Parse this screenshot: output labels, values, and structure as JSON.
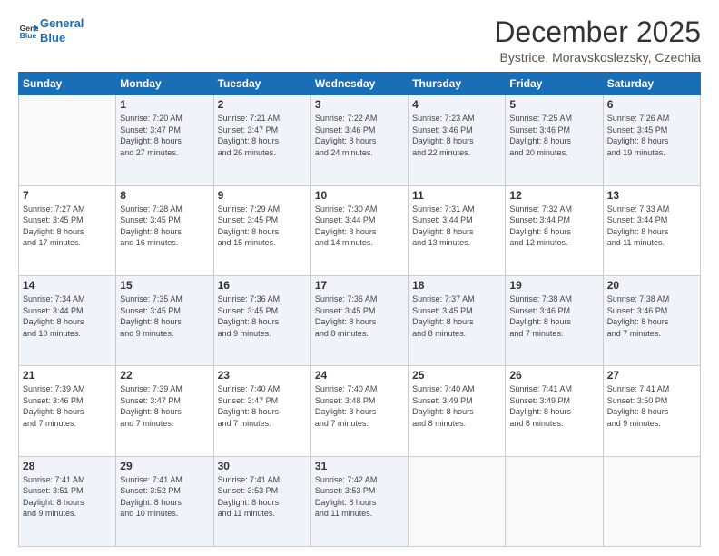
{
  "logo": {
    "line1": "General",
    "line2": "Blue"
  },
  "title": "December 2025",
  "subtitle": "Bystrice, Moravskoslezsky, Czechia",
  "days_header": [
    "Sunday",
    "Monday",
    "Tuesday",
    "Wednesday",
    "Thursday",
    "Friday",
    "Saturday"
  ],
  "weeks": [
    [
      {
        "day": "",
        "info": ""
      },
      {
        "day": "1",
        "info": "Sunrise: 7:20 AM\nSunset: 3:47 PM\nDaylight: 8 hours\nand 27 minutes."
      },
      {
        "day": "2",
        "info": "Sunrise: 7:21 AM\nSunset: 3:47 PM\nDaylight: 8 hours\nand 26 minutes."
      },
      {
        "day": "3",
        "info": "Sunrise: 7:22 AM\nSunset: 3:46 PM\nDaylight: 8 hours\nand 24 minutes."
      },
      {
        "day": "4",
        "info": "Sunrise: 7:23 AM\nSunset: 3:46 PM\nDaylight: 8 hours\nand 22 minutes."
      },
      {
        "day": "5",
        "info": "Sunrise: 7:25 AM\nSunset: 3:46 PM\nDaylight: 8 hours\nand 20 minutes."
      },
      {
        "day": "6",
        "info": "Sunrise: 7:26 AM\nSunset: 3:45 PM\nDaylight: 8 hours\nand 19 minutes."
      }
    ],
    [
      {
        "day": "7",
        "info": "Sunrise: 7:27 AM\nSunset: 3:45 PM\nDaylight: 8 hours\nand 17 minutes."
      },
      {
        "day": "8",
        "info": "Sunrise: 7:28 AM\nSunset: 3:45 PM\nDaylight: 8 hours\nand 16 minutes."
      },
      {
        "day": "9",
        "info": "Sunrise: 7:29 AM\nSunset: 3:45 PM\nDaylight: 8 hours\nand 15 minutes."
      },
      {
        "day": "10",
        "info": "Sunrise: 7:30 AM\nSunset: 3:44 PM\nDaylight: 8 hours\nand 14 minutes."
      },
      {
        "day": "11",
        "info": "Sunrise: 7:31 AM\nSunset: 3:44 PM\nDaylight: 8 hours\nand 13 minutes."
      },
      {
        "day": "12",
        "info": "Sunrise: 7:32 AM\nSunset: 3:44 PM\nDaylight: 8 hours\nand 12 minutes."
      },
      {
        "day": "13",
        "info": "Sunrise: 7:33 AM\nSunset: 3:44 PM\nDaylight: 8 hours\nand 11 minutes."
      }
    ],
    [
      {
        "day": "14",
        "info": "Sunrise: 7:34 AM\nSunset: 3:44 PM\nDaylight: 8 hours\nand 10 minutes."
      },
      {
        "day": "15",
        "info": "Sunrise: 7:35 AM\nSunset: 3:45 PM\nDaylight: 8 hours\nand 9 minutes."
      },
      {
        "day": "16",
        "info": "Sunrise: 7:36 AM\nSunset: 3:45 PM\nDaylight: 8 hours\nand 9 minutes."
      },
      {
        "day": "17",
        "info": "Sunrise: 7:36 AM\nSunset: 3:45 PM\nDaylight: 8 hours\nand 8 minutes."
      },
      {
        "day": "18",
        "info": "Sunrise: 7:37 AM\nSunset: 3:45 PM\nDaylight: 8 hours\nand 8 minutes."
      },
      {
        "day": "19",
        "info": "Sunrise: 7:38 AM\nSunset: 3:46 PM\nDaylight: 8 hours\nand 7 minutes."
      },
      {
        "day": "20",
        "info": "Sunrise: 7:38 AM\nSunset: 3:46 PM\nDaylight: 8 hours\nand 7 minutes."
      }
    ],
    [
      {
        "day": "21",
        "info": "Sunrise: 7:39 AM\nSunset: 3:46 PM\nDaylight: 8 hours\nand 7 minutes."
      },
      {
        "day": "22",
        "info": "Sunrise: 7:39 AM\nSunset: 3:47 PM\nDaylight: 8 hours\nand 7 minutes."
      },
      {
        "day": "23",
        "info": "Sunrise: 7:40 AM\nSunset: 3:47 PM\nDaylight: 8 hours\nand 7 minutes."
      },
      {
        "day": "24",
        "info": "Sunrise: 7:40 AM\nSunset: 3:48 PM\nDaylight: 8 hours\nand 7 minutes."
      },
      {
        "day": "25",
        "info": "Sunrise: 7:40 AM\nSunset: 3:49 PM\nDaylight: 8 hours\nand 8 minutes."
      },
      {
        "day": "26",
        "info": "Sunrise: 7:41 AM\nSunset: 3:49 PM\nDaylight: 8 hours\nand 8 minutes."
      },
      {
        "day": "27",
        "info": "Sunrise: 7:41 AM\nSunset: 3:50 PM\nDaylight: 8 hours\nand 9 minutes."
      }
    ],
    [
      {
        "day": "28",
        "info": "Sunrise: 7:41 AM\nSunset: 3:51 PM\nDaylight: 8 hours\nand 9 minutes."
      },
      {
        "day": "29",
        "info": "Sunrise: 7:41 AM\nSunset: 3:52 PM\nDaylight: 8 hours\nand 10 minutes."
      },
      {
        "day": "30",
        "info": "Sunrise: 7:41 AM\nSunset: 3:53 PM\nDaylight: 8 hours\nand 11 minutes."
      },
      {
        "day": "31",
        "info": "Sunrise: 7:42 AM\nSunset: 3:53 PM\nDaylight: 8 hours\nand 11 minutes."
      },
      {
        "day": "",
        "info": ""
      },
      {
        "day": "",
        "info": ""
      },
      {
        "day": "",
        "info": ""
      }
    ]
  ]
}
